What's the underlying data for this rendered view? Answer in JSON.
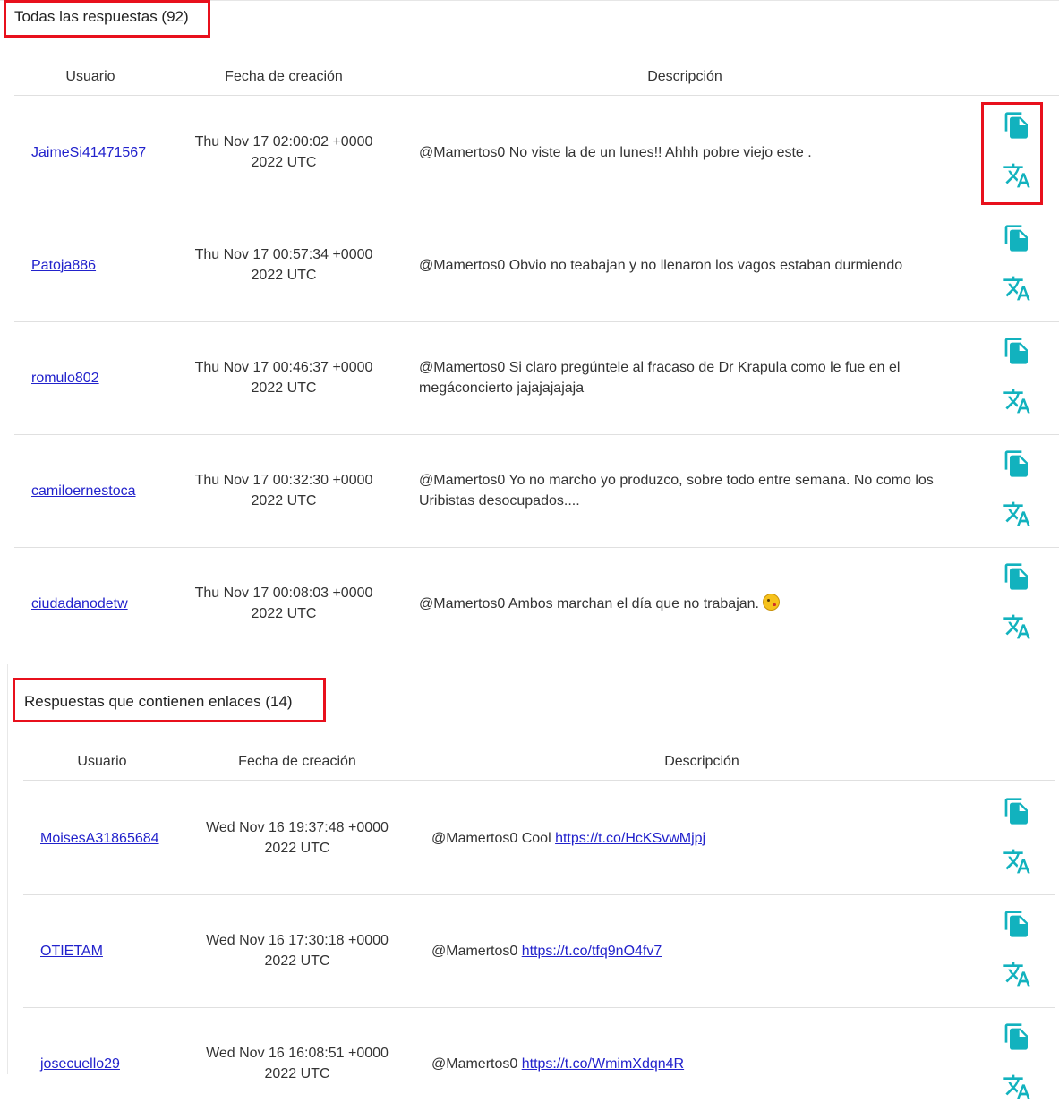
{
  "colors": {
    "accent_icon": "#12b2be",
    "link": "#2222cc",
    "highlight": "#e8101c"
  },
  "icons": {
    "copy": "copy-icon",
    "translate": "translate-icon"
  },
  "section_all": {
    "title": "Todas las respuestas (92)",
    "columns": {
      "user": "Usuario",
      "date": "Fecha de creación",
      "desc": "Descripción"
    },
    "rows": [
      {
        "user": "JaimeSi41471567",
        "date": "Thu Nov 17 02:00:02 +0000 2022 UTC",
        "text": "@Mamertos0 No viste la de un lunes!! Ahhh pobre viejo este ."
      },
      {
        "user": "Patoja886",
        "date": "Thu Nov 17 00:57:34 +0000 2022 UTC",
        "text": "@Mamertos0 Obvio no teabajan y no llenaron los vagos estaban durmiendo"
      },
      {
        "user": "romulo802",
        "date": "Thu Nov 17 00:46:37 +0000 2022 UTC",
        "text": "@Mamertos0 Si claro pregúntele al fracaso de Dr Krapula como le fue en el megáconcierto jajajajajaja"
      },
      {
        "user": "camiloernestoca",
        "date": "Thu Nov 17 00:32:30 +0000 2022 UTC",
        "text": "@Mamertos0 Yo no marcho yo produzco, sobre todo entre semana. No como los Uribistas desocupados...."
      },
      {
        "user": "ciudadanodetw",
        "date": "Thu Nov 17 00:08:03 +0000 2022 UTC",
        "text": "@Mamertos0 Ambos marchan el día que no trabajan.",
        "emoji": "face-blowing-kiss-emoji"
      }
    ]
  },
  "section_links": {
    "title": "Respuestas que contienen enlaces (14)",
    "columns": {
      "user": "Usuario",
      "date": "Fecha de creación",
      "desc": "Descripción"
    },
    "rows": [
      {
        "user": "MoisesA31865684",
        "date": "Wed Nov 16 19:37:48 +0000 2022 UTC",
        "text": "@Mamertos0 Cool",
        "link": "https://t.co/HcKSvwMjpj"
      },
      {
        "user": "OTIETAM",
        "date": "Wed Nov 16 17:30:18 +0000 2022 UTC",
        "text": "@Mamertos0",
        "link": "https://t.co/tfq9nO4fv7"
      },
      {
        "user": "josecuello29",
        "date": "Wed Nov 16 16:08:51 +0000 2022 UTC",
        "text": "@Mamertos0",
        "link": "https://t.co/WmimXdqn4R"
      }
    ]
  }
}
